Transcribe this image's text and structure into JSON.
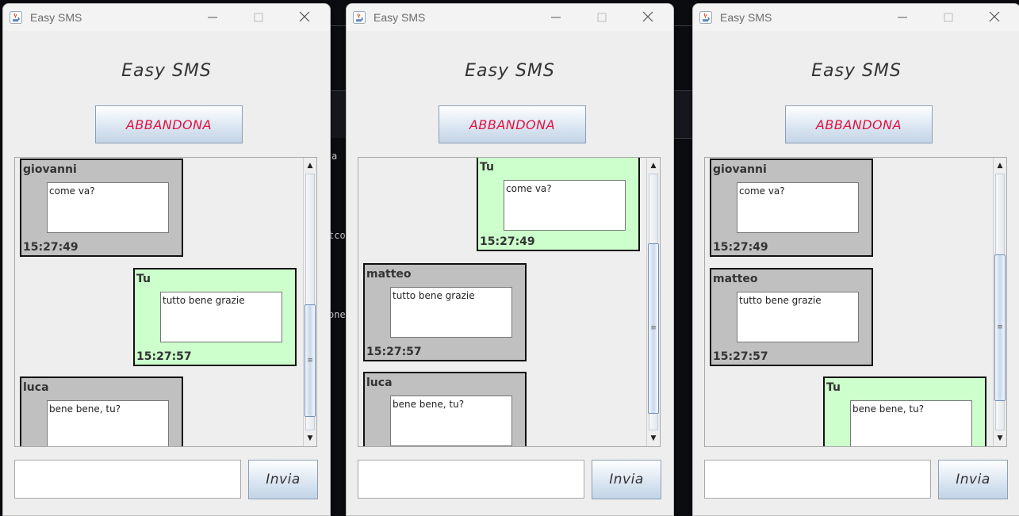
{
  "background_fragments": [
    "a",
    "tco",
    "one"
  ],
  "windows": [
    {
      "title": "Easy SMS",
      "heading": "Easy SMS",
      "leave_label": "ABBANDONA",
      "send_label": "Invia",
      "input_value": "",
      "messages": [
        {
          "sender": "giovanni",
          "text": "come va?",
          "time": "15:27:49",
          "mine": false
        },
        {
          "sender": "Tu",
          "text": "tutto bene grazie",
          "time": "15:27:57",
          "mine": true
        },
        {
          "sender": "luca",
          "text": "bene bene, tu?",
          "time": "",
          "mine": false
        }
      ],
      "scroll_position": 0.95
    },
    {
      "title": "Easy SMS",
      "heading": "Easy SMS",
      "leave_label": "ABBANDONA",
      "send_label": "Invia",
      "input_value": "",
      "messages": [
        {
          "sender": "Tu",
          "text": "come va?",
          "time": "15:27:49",
          "mine": true
        },
        {
          "sender": "matteo",
          "text": "tutto bene grazie",
          "time": "15:27:57",
          "mine": false
        },
        {
          "sender": "luca",
          "text": "bene bene, tu?",
          "time": "",
          "mine": false
        }
      ],
      "scroll_position": 0.5
    },
    {
      "title": "Easy SMS",
      "heading": "Easy SMS",
      "leave_label": "ABBANDONA",
      "send_label": "Invia",
      "input_value": "",
      "messages": [
        {
          "sender": "giovanni",
          "text": "come va?",
          "time": "15:27:49",
          "mine": false
        },
        {
          "sender": "matteo",
          "text": "tutto bene grazie",
          "time": "15:27:57",
          "mine": false
        },
        {
          "sender": "Tu",
          "text": "bene bene, tu?",
          "time": "",
          "mine": true
        }
      ],
      "scroll_position": 0.8
    }
  ],
  "colors": {
    "mine_bubble": "#ccffcc",
    "other_bubble": "#c0c0c0",
    "leave_text": "#e0103f"
  },
  "icons": [
    "java-app-icon",
    "minimize-icon",
    "maximize-icon",
    "close-icon",
    "scroll-up-arrow-icon",
    "scroll-down-arrow-icon"
  ]
}
